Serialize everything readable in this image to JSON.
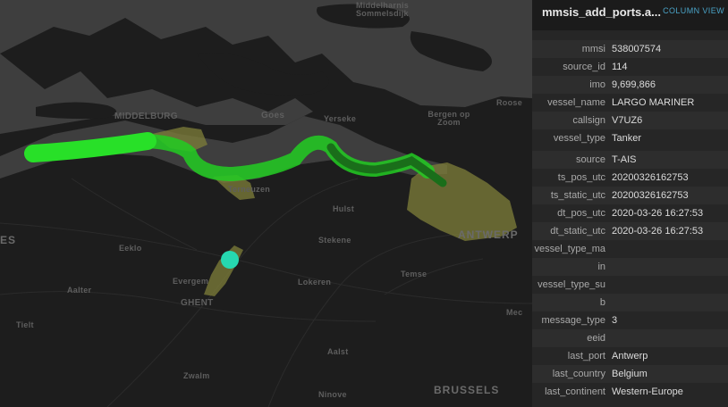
{
  "panel": {
    "title": "mmsis_add_ports.a...",
    "column_view_label": "COLUMN VIEW",
    "rows": [
      {
        "key": "mmsi",
        "value": "538007574"
      },
      {
        "key": "source_id",
        "value": "114"
      },
      {
        "key": "imo",
        "value": "9,699,866"
      },
      {
        "key": "vessel_name",
        "value": "LARGO MARINER"
      },
      {
        "key": "callsign",
        "value": "V7UZ6"
      },
      {
        "key": "vessel_type",
        "value": "Tanker"
      },
      {
        "key": "source",
        "value": "T-AIS"
      },
      {
        "key": "ts_pos_utc",
        "value": "20200326162753"
      },
      {
        "key": "ts_static_utc",
        "value": "20200326162753"
      },
      {
        "key": "dt_pos_utc",
        "value": "2020-03-26 16:27:53"
      },
      {
        "key": "dt_static_utc",
        "value": "2020-03-26 16:27:53"
      },
      {
        "key": "vessel_type_ma",
        "value": ""
      },
      {
        "key": "in",
        "value": ""
      },
      {
        "key": "vessel_type_su",
        "value": ""
      },
      {
        "key": "b",
        "value": ""
      },
      {
        "key": "message_type",
        "value": "3"
      },
      {
        "key": "eeid",
        "value": ""
      },
      {
        "key": "last_port",
        "value": "Antwerp"
      },
      {
        "key": "last_country",
        "value": "Belgium"
      },
      {
        "key": "last_continent",
        "value": "Western-Europe"
      }
    ]
  },
  "map": {
    "labels": {
      "middelharnis": "Middelharnis",
      "sommelsdijk": "Sommelsdijk",
      "middelburg": "MIDDELBURG",
      "goes": "Goes",
      "yerseke": "Yerseke",
      "bergen_op_zoom": "Bergen op Zoom",
      "roosendaal": "Roose",
      "terneuzen": "Terneuzen",
      "hulst": "Hulst",
      "antwerpen": "ANTWERP",
      "stekene": "Stekene",
      "eeklo": "Eeklo",
      "es": "ES",
      "aalter": "Aalter",
      "evergem": "Evergem",
      "lokeren": "Lokeren",
      "temse": "Temse",
      "ghent": "GHENT",
      "tielt": "Tielt",
      "aalst": "Aalst",
      "zwalm": "Zwalm",
      "ninove": "Ninove",
      "brussels": "BRUSSELS",
      "mec": "Mec"
    },
    "colors": {
      "background": "#1d1d1d",
      "water": "#3f3f3f",
      "track": "#22cc22",
      "port_area": "#8a8a3c",
      "position_marker": "#26d8b0"
    }
  }
}
